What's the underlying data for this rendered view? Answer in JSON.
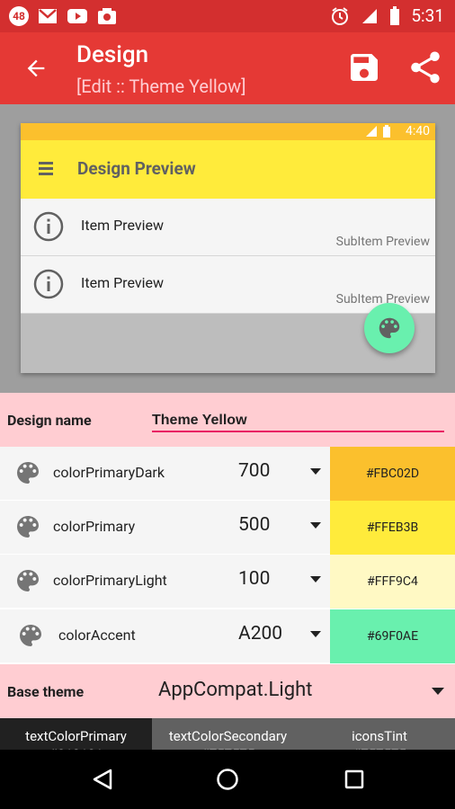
{
  "status_bar": {
    "badge": "48",
    "time": "5:31",
    "icons": [
      "gmail-icon",
      "youtube-icon",
      "photos-icon",
      "alarm-icon",
      "signal-icon",
      "battery-icon"
    ]
  },
  "app_bar": {
    "title": "Design",
    "subtitle": "[Edit :: Theme Yellow]",
    "actions": [
      "save-icon",
      "share-icon"
    ]
  },
  "preview": {
    "time": "4:40",
    "toolbar_title": "Design Preview",
    "items": [
      {
        "title": "Item Preview",
        "subtitle": "SubItem Preview"
      },
      {
        "title": "Item Preview",
        "subtitle": "SubItem Preview"
      }
    ]
  },
  "design_name": {
    "label": "Design name",
    "value": "Theme Yellow"
  },
  "colors": [
    {
      "name": "colorPrimaryDark",
      "shade": "700",
      "hex": "#FBC02D"
    },
    {
      "name": "colorPrimary",
      "shade": "500",
      "hex": "#FFEB3B"
    },
    {
      "name": "colorPrimaryLight",
      "shade": "100",
      "hex": "#FFF9C4"
    },
    {
      "name": "colorAccent",
      "shade": "A200",
      "hex": "#69F0AE"
    }
  ],
  "base_theme": {
    "label": "Base theme",
    "value": "AppCompat.Light"
  },
  "tabs": [
    {
      "label": "textColorPrimary",
      "value": "#212121"
    },
    {
      "label": "textColorSecondary",
      "value": "#757575"
    },
    {
      "label": "iconsTint",
      "value": "#757575"
    }
  ],
  "theme": {
    "app_bar": "#E53935",
    "status_bar": "#D32F2F",
    "input_underline": "#E91E63",
    "row_highlight": "#FFCDD2"
  }
}
